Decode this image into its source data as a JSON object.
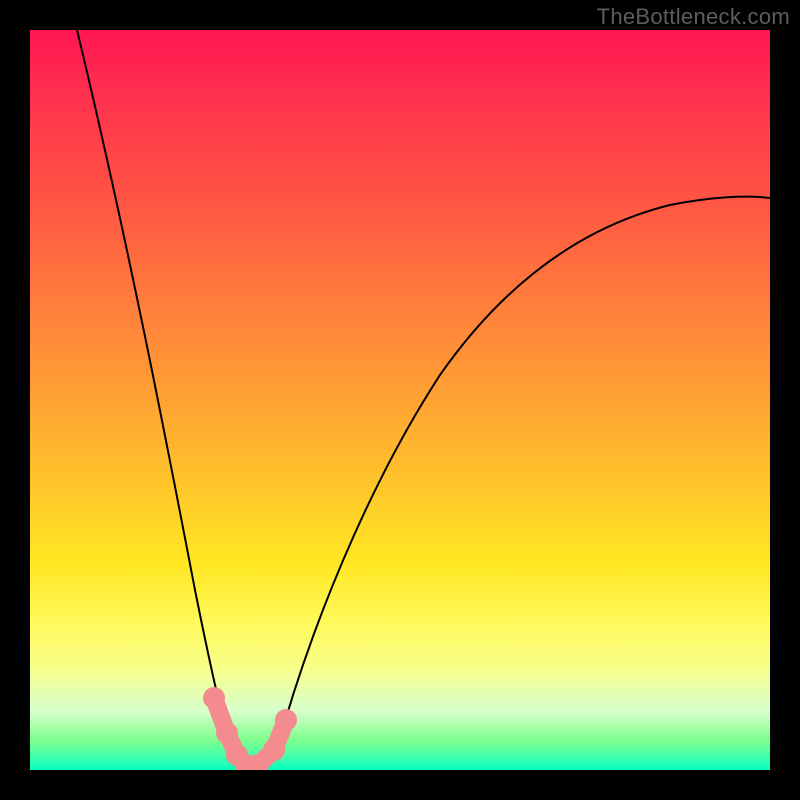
{
  "watermark": "TheBottleneck.com",
  "colors": {
    "page_bg": "#000000",
    "gradient_top": "#ff1552",
    "gradient_bottom": "#00ffc0",
    "curve": "#000000",
    "markers": "#f48b8f",
    "watermark_text": "#5d5d5d"
  },
  "chart_data": {
    "type": "line",
    "title": "",
    "xlabel": "",
    "ylabel": "",
    "xlim": [
      0,
      100
    ],
    "ylim": [
      0,
      100
    ],
    "grid": false,
    "notes": "V-shaped bottleneck curve. Minimum lies at roughly x≈28 where value≈0. Left branch enters from the top-left corner; right branch exits near the top-right around y≈77. Background vertical gradient encodes value: red≈high, green≈low. Pink dot markers sit along the trough highlighting the ideal-balance region.",
    "series": [
      {
        "name": "bottleneck-curve",
        "x": [
          0,
          5,
          10,
          15,
          20,
          23,
          25,
          27,
          28,
          30,
          33,
          36,
          40,
          45,
          50,
          55,
          60,
          65,
          70,
          75,
          80,
          85,
          90,
          95,
          100
        ],
        "values": [
          100,
          86,
          71,
          55,
          36,
          21,
          10,
          2,
          0,
          0,
          2,
          9,
          19,
          30,
          39,
          46,
          52,
          57,
          62,
          66,
          69,
          72,
          74,
          76,
          77
        ]
      }
    ],
    "markers": [
      {
        "x": 23,
        "y": 12
      },
      {
        "x": 25,
        "y": 5
      },
      {
        "x": 26,
        "y": 1
      },
      {
        "x": 28,
        "y": 0
      },
      {
        "x": 30,
        "y": 0
      },
      {
        "x": 33,
        "y": 4
      },
      {
        "x": 34,
        "y": 9
      }
    ]
  }
}
